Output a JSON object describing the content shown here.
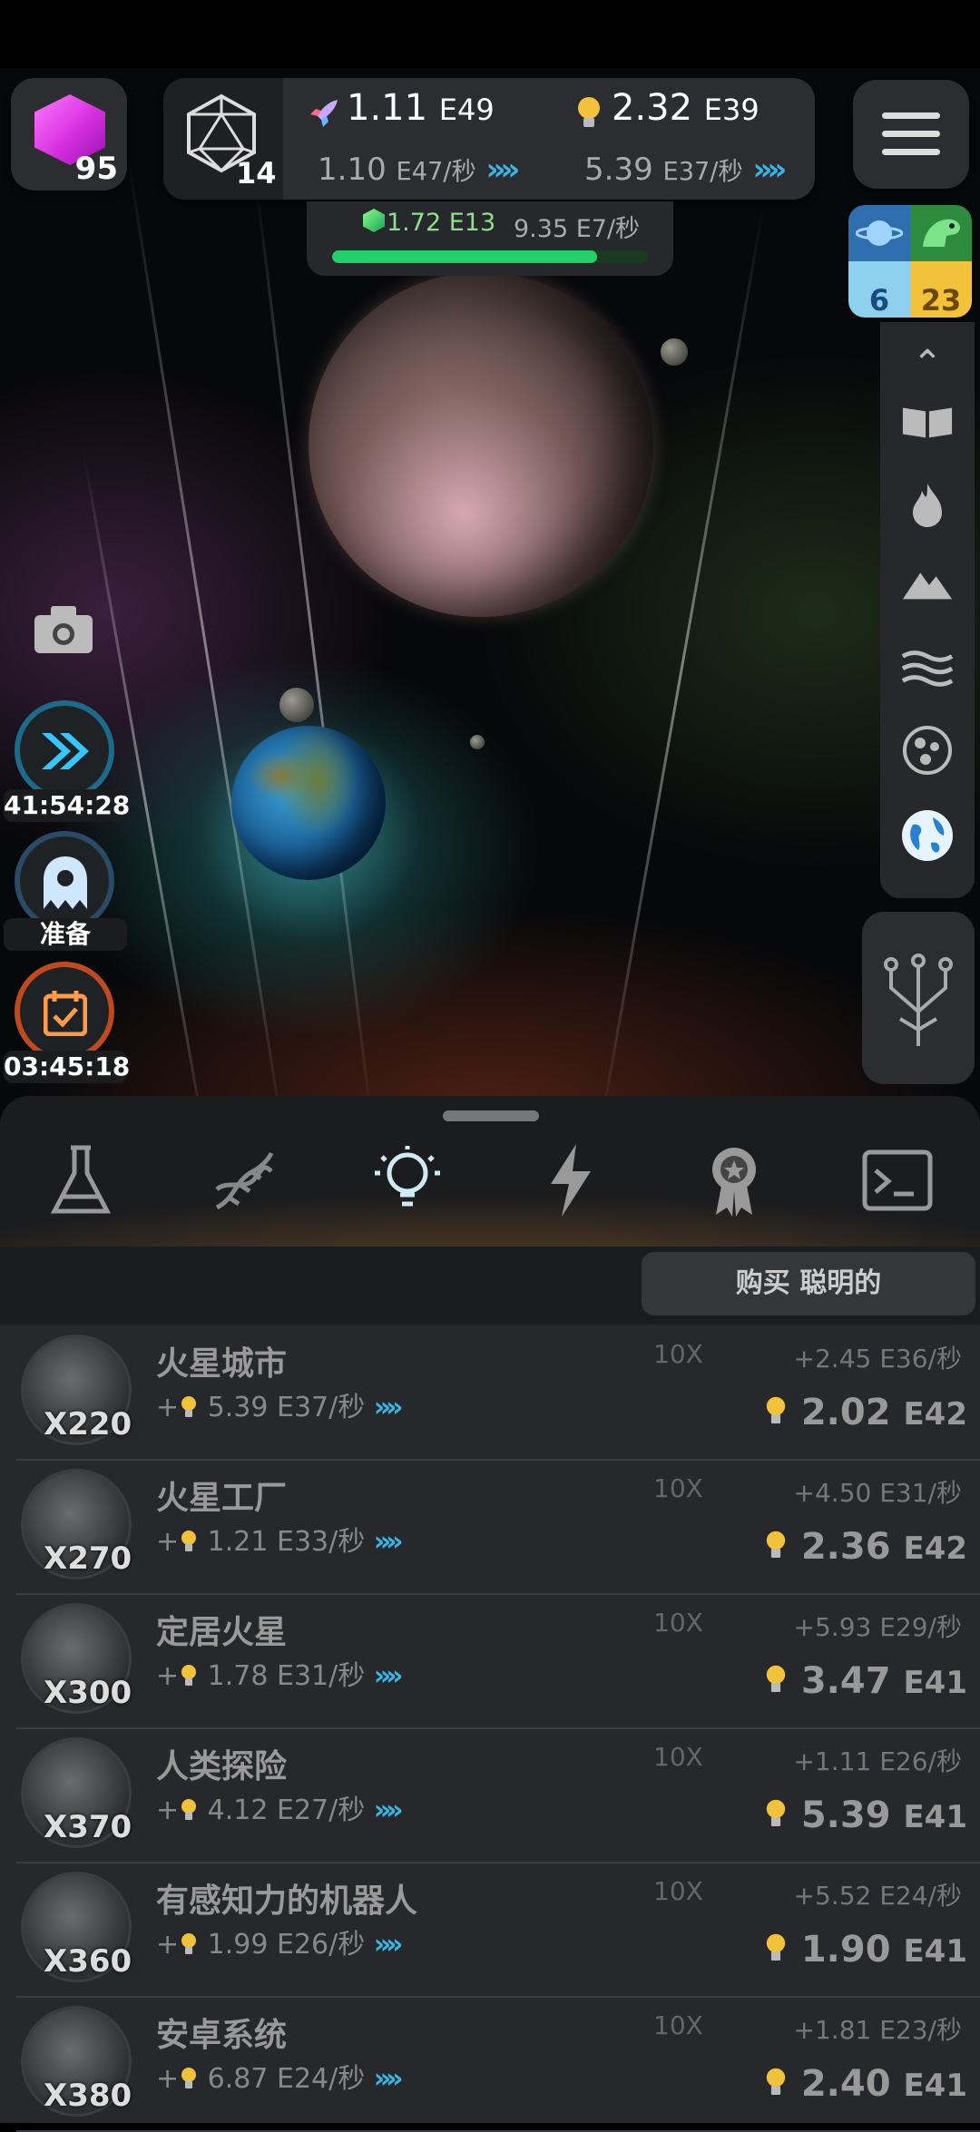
{
  "top_left": {
    "cube_count": "95"
  },
  "resources": {
    "level": "14",
    "rocket_value": "1.11",
    "rocket_exp": "E49",
    "rocket_rate": "1.10",
    "rocket_rate_exp": "E47/秒",
    "idea_value": "2.32",
    "idea_exp": "E39",
    "idea_rate": "5.39",
    "idea_rate_exp": "E37/秒",
    "chevron": "»"
  },
  "sub_panel": {
    "value": "1.72",
    "value_exp": "E13",
    "rate": "9.35",
    "rate_exp": "E7/秒",
    "progress_fraction": 0.84
  },
  "corner_tiles": {
    "planet_count": "6",
    "dino_count": "23"
  },
  "left_buttons": {
    "boost_timer": "41:54:28",
    "ghost_status": "准备",
    "calendar_timer": "03:45:18"
  },
  "buy_button": "购买 聪明的",
  "colors": {
    "accent": "#37b7e6",
    "progress": "#22d06a",
    "bulb": "#f2c23a"
  },
  "items": [
    {
      "name": "火星城市",
      "mult": "X220",
      "rate": "5.39",
      "rate_exp": "E37/秒",
      "ten": "10X",
      "gain": "+2.45",
      "gain_exp": "E36/秒",
      "cost": "2.02",
      "cost_exp": "E42"
    },
    {
      "name": "火星工厂",
      "mult": "X270",
      "rate": "1.21",
      "rate_exp": "E33/秒",
      "ten": "10X",
      "gain": "+4.50",
      "gain_exp": "E31/秒",
      "cost": "2.36",
      "cost_exp": "E42"
    },
    {
      "name": "定居火星",
      "mult": "X300",
      "rate": "1.78",
      "rate_exp": "E31/秒",
      "ten": "10X",
      "gain": "+5.93",
      "gain_exp": "E29/秒",
      "cost": "3.47",
      "cost_exp": "E41"
    },
    {
      "name": "人类探险",
      "mult": "X370",
      "rate": "4.12",
      "rate_exp": "E27/秒",
      "ten": "10X",
      "gain": "+1.11",
      "gain_exp": "E26/秒",
      "cost": "5.39",
      "cost_exp": "E41"
    },
    {
      "name": "有感知力的机器人",
      "mult": "X360",
      "rate": "1.99",
      "rate_exp": "E26/秒",
      "ten": "10X",
      "gain": "+5.52",
      "gain_exp": "E24/秒",
      "cost": "1.90",
      "cost_exp": "E41"
    },
    {
      "name": "安卓系统",
      "mult": "X380",
      "rate": "6.87",
      "rate_exp": "E24/秒",
      "ten": "10X",
      "gain": "+1.81",
      "gain_exp": "E23/秒",
      "cost": "2.40",
      "cost_exp": "E41"
    }
  ],
  "row_plus": "+"
}
